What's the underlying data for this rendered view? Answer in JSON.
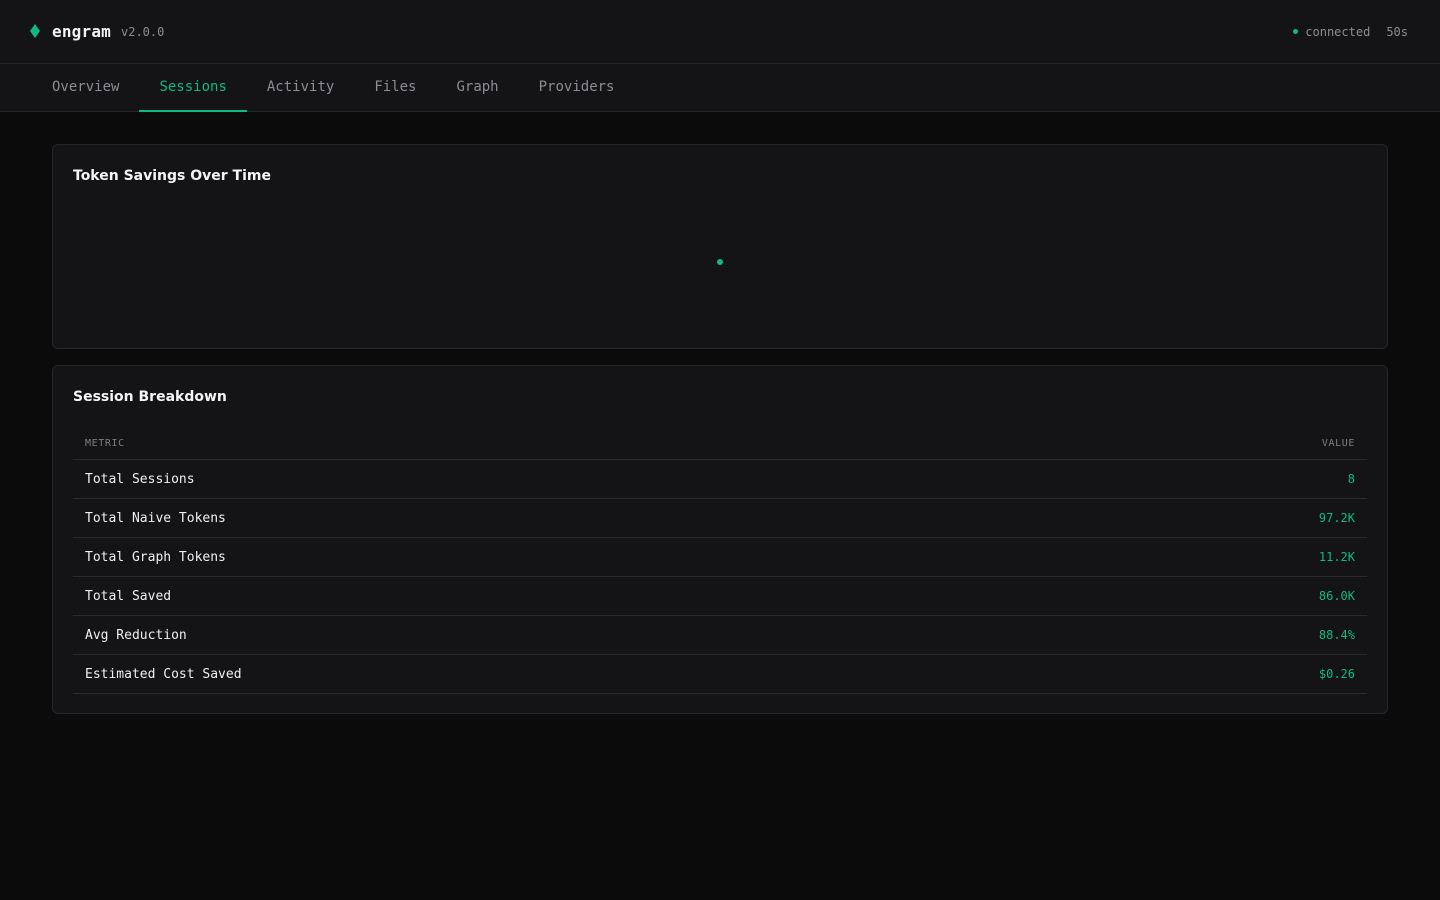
{
  "colors": {
    "accent": "#10b981",
    "background": "#0b0b0c",
    "panel": "#141416",
    "border": "#26272a",
    "muted": "#8b8d92"
  },
  "header": {
    "brand_icon": "diamond-icon",
    "app_name": "engram",
    "version": "v2.0.0",
    "status_text": "connected",
    "uptime": "50s"
  },
  "tabs": [
    {
      "label": "Overview",
      "active": false
    },
    {
      "label": "Sessions",
      "active": true
    },
    {
      "label": "Activity",
      "active": false
    },
    {
      "label": "Files",
      "active": false
    },
    {
      "label": "Graph",
      "active": false
    },
    {
      "label": "Providers",
      "active": false
    }
  ],
  "chart_panel": {
    "title": "Token Savings Over Time"
  },
  "chart_data": {
    "type": "scatter",
    "title": "Token Savings Over Time",
    "xlabel": "",
    "ylabel": "",
    "grid": false,
    "series": [
      {
        "x": [
          0
        ],
        "y": [
          0
        ]
      }
    ]
  },
  "breakdown": {
    "title": "Session Breakdown",
    "columns": [
      "METRIC",
      "VALUE"
    ],
    "rows": [
      {
        "metric": "Total Sessions",
        "value": "8"
      },
      {
        "metric": "Total Naive Tokens",
        "value": "97.2K"
      },
      {
        "metric": "Total Graph Tokens",
        "value": "11.2K"
      },
      {
        "metric": "Total Saved",
        "value": "86.0K"
      },
      {
        "metric": "Avg Reduction",
        "value": "88.4%"
      },
      {
        "metric": "Estimated Cost Saved",
        "value": "$0.26"
      }
    ]
  }
}
